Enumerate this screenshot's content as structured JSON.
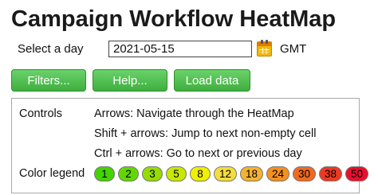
{
  "page": {
    "title": "Campaign Workflow HeatMap"
  },
  "day_selector": {
    "label": "Select a day",
    "value": "2021-05-15",
    "timezone": "GMT",
    "calendar_icon": "calendar-icon"
  },
  "buttons": {
    "filters": "Filters...",
    "help": "Help...",
    "load": "Load data"
  },
  "controls": {
    "label": "Controls",
    "lines": [
      "Arrows: Navigate through the HeatMap",
      "Shift + arrows: Jump to next non-empty cell",
      "Ctrl + arrows: Go to next or previous day"
    ]
  },
  "legend": {
    "label": "Color legend",
    "items": [
      {
        "value": "1",
        "color": "#44d300"
      },
      {
        "value": "2",
        "color": "#63d800"
      },
      {
        "value": "3",
        "color": "#95dc00"
      },
      {
        "value": "5",
        "color": "#c8e800"
      },
      {
        "value": "8",
        "color": "#f0f000"
      },
      {
        "value": "12",
        "color": "#f5dc3c"
      },
      {
        "value": "18",
        "color": "#f5b232"
      },
      {
        "value": "24",
        "color": "#f49020"
      },
      {
        "value": "30",
        "color": "#f06a20"
      },
      {
        "value": "38",
        "color": "#ec3a22"
      },
      {
        "value": "50",
        "color": "#e8102e"
      }
    ]
  }
}
